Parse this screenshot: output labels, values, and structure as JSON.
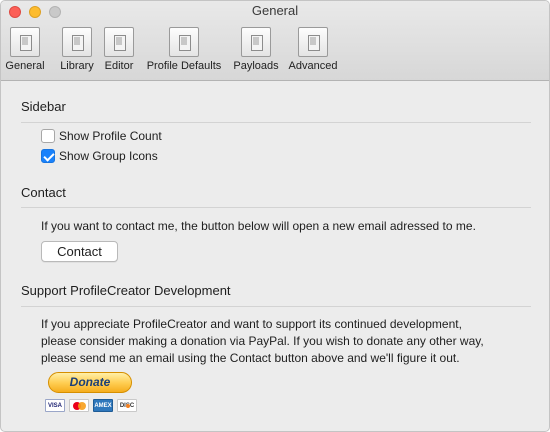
{
  "window": {
    "title": "General"
  },
  "toolbar": {
    "tabs": [
      {
        "label": "General",
        "icon": "general-icon"
      },
      {
        "label": "Library",
        "icon": "library-icon"
      },
      {
        "label": "Editor",
        "icon": "editor-icon"
      },
      {
        "label": "Profile Defaults",
        "icon": "profile-defaults-icon"
      },
      {
        "label": "Payloads",
        "icon": "payloads-icon"
      },
      {
        "label": "Advanced",
        "icon": "advanced-icon"
      }
    ],
    "selected": "General"
  },
  "sidebar_section": {
    "title": "Sidebar",
    "options": [
      {
        "label": "Show Profile Count",
        "checked": false
      },
      {
        "label": "Show Group Icons",
        "checked": true
      }
    ]
  },
  "contact_section": {
    "title": "Contact",
    "text": "If you want to contact me, the button below will open a new email adressed to me.",
    "button_label": "Contact"
  },
  "support_section": {
    "title": "Support ProfileCreator Development",
    "lines": [
      "If you appreciate ProfileCreator and want to support its continued development,",
      "please consider making a donation via PayPal. If you wish to donate any other way,",
      "please send me an email using the Contact button above and we'll figure it out."
    ],
    "donate_label": "Donate",
    "cards": [
      "VISA",
      "",
      "AMEX",
      "DISC"
    ]
  },
  "colors": {
    "accent": "#1a82fb",
    "close": "#fc5f57",
    "minimize": "#fdbc2e",
    "donate_text": "#1b3f77"
  }
}
